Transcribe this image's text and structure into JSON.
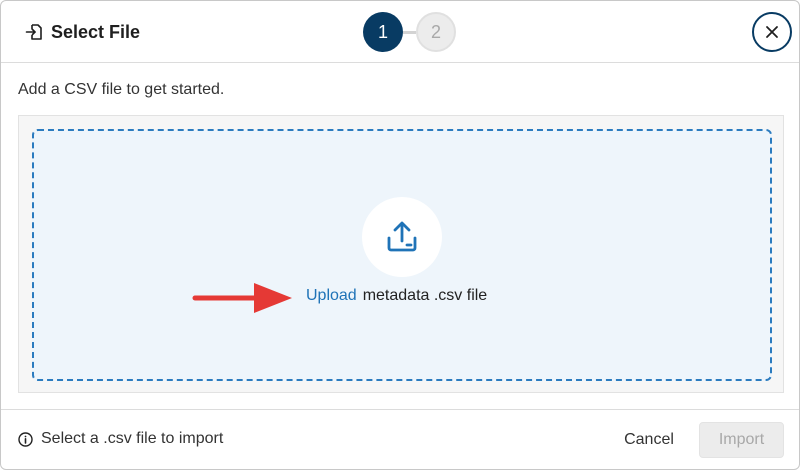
{
  "dialog": {
    "title": "Select File",
    "title_icon": "file-import-icon",
    "close_icon": "close-icon"
  },
  "stepper": {
    "steps": [
      {
        "label": "1",
        "state": "active"
      },
      {
        "label": "2",
        "state": "inactive"
      }
    ]
  },
  "body": {
    "instruction": "Add a CSV file to get started.",
    "upload_icon": "upload-icon",
    "upload_link": "Upload",
    "upload_text": "metadata .csv file",
    "annotation_icon": "red-arrow-icon"
  },
  "footer": {
    "info_icon": "info-icon",
    "info_text": "Select a .csv file to import",
    "cancel_label": "Cancel",
    "import_label": "Import"
  },
  "colors": {
    "primary_dark": "#083b63",
    "link_blue": "#1f73b7",
    "dashed_border": "#2b7bbf",
    "arrow_red": "#e53935",
    "disabled_text": "#a8a8a8"
  }
}
